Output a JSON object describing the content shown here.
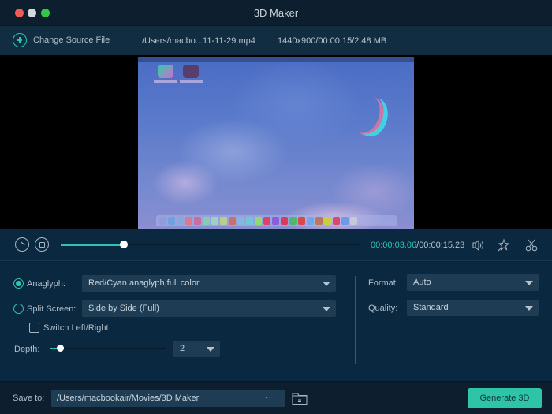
{
  "window": {
    "title": "3D Maker"
  },
  "source": {
    "change_label": "Change Source File",
    "path": "/Users/macbo...11-11-29.mp4",
    "meta": "1440x900/00:00:15/2.48 MB"
  },
  "player": {
    "progress_fraction": 0.21,
    "current_time": "00:00:03.06",
    "separator": "/",
    "total_time": "00:00:15.23",
    "icons": [
      "play-icon",
      "stop-icon",
      "volume-icon",
      "effect-icon",
      "scissors-icon"
    ]
  },
  "settings": {
    "anaglyph": {
      "label": "Anaglyph:",
      "value": "Red/Cyan anaglyph,full color",
      "selected": true
    },
    "split_screen": {
      "label": "Split Screen:",
      "value": "Side by Side (Full)",
      "selected": false
    },
    "switch_lr": {
      "label": "Switch Left/Right",
      "checked": false
    },
    "depth": {
      "label": "Depth:",
      "slider_fraction": 0.09,
      "value": "2"
    },
    "format": {
      "label": "Format:",
      "value": "Auto"
    },
    "quality": {
      "label": "Quality:",
      "value": "Standard"
    }
  },
  "footer": {
    "save_label": "Save to:",
    "save_path": "/Users/macbookair/Movies/3D Maker",
    "more_label": "···",
    "generate_label": "Generate 3D"
  },
  "colors": {
    "accent": "#2ec4b0",
    "background": "#0b2841",
    "titlebar": "#0d1f2e"
  }
}
